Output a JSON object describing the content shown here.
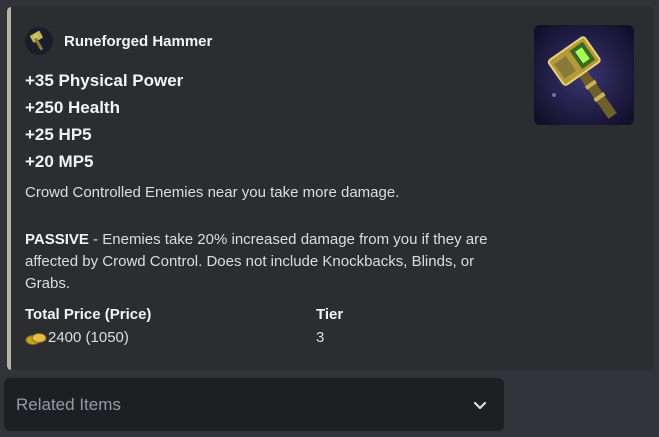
{
  "embed": {
    "author_name": "Runeforged Hammer",
    "accent_color": "#b5b5a8",
    "stats": [
      "+35 Physical Power",
      "+250 Health",
      "+25 HP5",
      "+20 MP5"
    ],
    "description": "Crowd Controlled Enemies near you take more damage.",
    "passive_label": "PASSIVE",
    "passive_text": " - Enemies take 20% increased damage from you if they are affected by Crowd Control. Does not include Knockbacks, Blinds, or Grabs.",
    "fields": [
      {
        "name": "Total Price (Price)",
        "value": "2400 (1050)",
        "icon": "gold-coins-icon"
      },
      {
        "name": "Tier",
        "value": "3"
      }
    ],
    "thumbnail_icon": "hammer-item-icon"
  },
  "select_menu": {
    "placeholder": "Related Items",
    "icon": "chevron-down-icon"
  }
}
